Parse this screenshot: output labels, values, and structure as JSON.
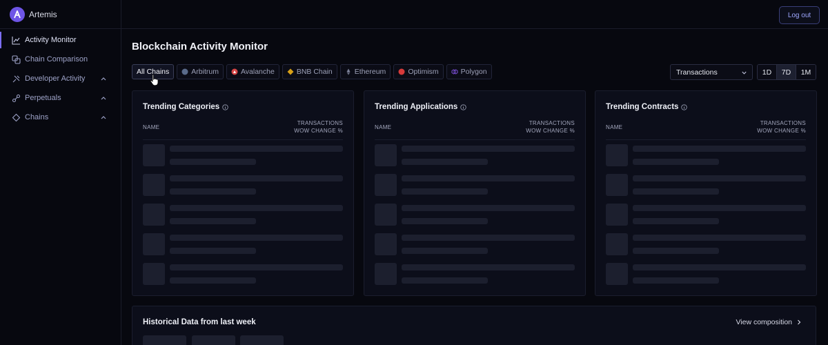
{
  "app": {
    "name": "Artemis"
  },
  "sidebar": {
    "items": [
      {
        "label": "Activity Monitor",
        "icon": "activity-chart-icon",
        "active": true,
        "expandable": false
      },
      {
        "label": "Chain Comparison",
        "icon": "compare-icon",
        "active": false,
        "expandable": false
      },
      {
        "label": "Developer Activity",
        "icon": "developer-icon",
        "active": false,
        "expandable": true
      },
      {
        "label": "Perpetuals",
        "icon": "link-icon",
        "active": false,
        "expandable": true
      },
      {
        "label": "Chains",
        "icon": "diamond-icon",
        "active": false,
        "expandable": true
      }
    ]
  },
  "header": {
    "logout_label": "Log out"
  },
  "page": {
    "title": "Blockchain Activity Monitor"
  },
  "filters": {
    "chains": [
      {
        "label": "All Chains",
        "icon": "",
        "active": true,
        "color": ""
      },
      {
        "label": "Arbitrum",
        "icon": "arbitrum-icon",
        "active": false,
        "color": "#5a6b8a"
      },
      {
        "label": "Avalanche",
        "icon": "avalanche-icon",
        "active": false,
        "color": "#d64545"
      },
      {
        "label": "BNB Chain",
        "icon": "bnb-icon",
        "active": false,
        "color": "#d8a017"
      },
      {
        "label": "Ethereum",
        "icon": "ethereum-icon",
        "active": false,
        "color": "#7a7f96"
      },
      {
        "label": "Optimism",
        "icon": "optimism-icon",
        "active": false,
        "color": "#d63a3a"
      },
      {
        "label": "Polygon",
        "icon": "polygon-icon",
        "active": false,
        "color": "#7b4fd6"
      }
    ],
    "metric": {
      "selected": "Transactions"
    },
    "ranges": [
      {
        "label": "1D",
        "active": false
      },
      {
        "label": "7D",
        "active": true
      },
      {
        "label": "1M",
        "active": false
      }
    ]
  },
  "cards": [
    {
      "title": "Trending Categories",
      "col_name": "NAME",
      "col_metric_1": "TRANSACTIONS",
      "col_metric_2": "WOW CHANGE %"
    },
    {
      "title": "Trending Applications",
      "col_name": "NAME",
      "col_metric_1": "TRANSACTIONS",
      "col_metric_2": "WOW CHANGE %"
    },
    {
      "title": "Trending Contracts",
      "col_name": "NAME",
      "col_metric_1": "TRANSACTIONS",
      "col_metric_2": "WOW CHANGE %"
    }
  ],
  "historical": {
    "title": "Historical Data from last week",
    "view_label": "View composition"
  },
  "theme": {
    "accent": "#7c6ef2",
    "background": "#07080f",
    "card": "#0c0e1a",
    "skeleton": "#1c1f2e"
  }
}
